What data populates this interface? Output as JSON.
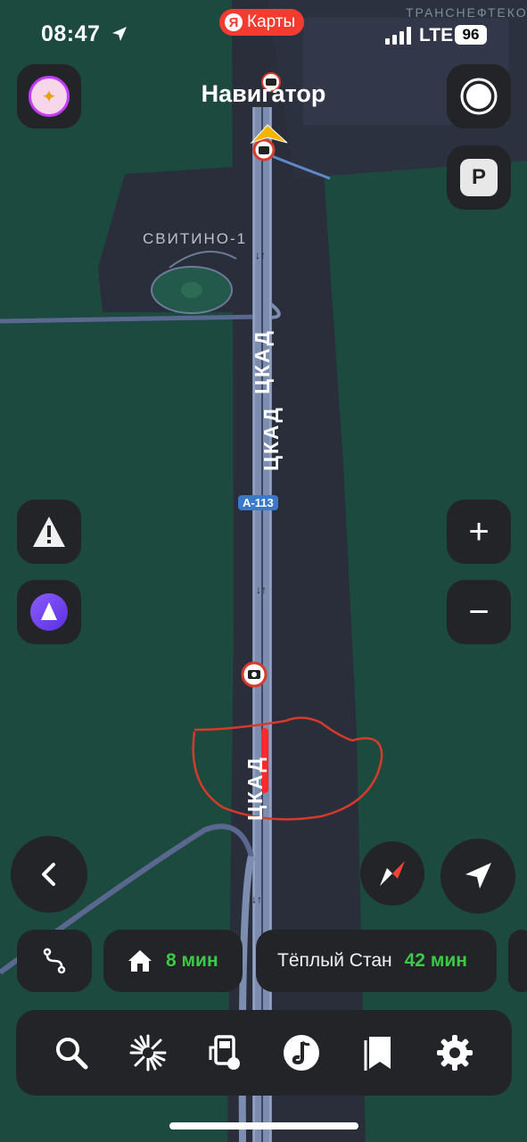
{
  "status": {
    "time": "08:47",
    "network": "LTE",
    "battery": "96",
    "app_pill": "Карты",
    "app_pill_logo": "Я"
  },
  "map": {
    "top_corner_label": "ТРАНСНЕФТЕКОМП",
    "place_label": "СВИТИНО-1",
    "road_label_1": "ЦКАД",
    "road_label_2": "ЦКАД",
    "road_label_3": "ЦКАД",
    "route_shield": "А-113",
    "colors": {
      "land": "#1c4a3e",
      "urban": "#2a2e3b",
      "road": "#7d8db0",
      "annotation": "#d53a2b",
      "accent_green": "#3cc948",
      "marker_yellow": "#f5b400"
    }
  },
  "header": {
    "title": "Навигатор"
  },
  "chips": [
    {
      "icon": "route-icon"
    },
    {
      "icon": "home-icon",
      "eta": "8 мин"
    },
    {
      "label": "Тёплый Стан",
      "eta": "42 мин"
    }
  ],
  "icons": {
    "left_top": "sparkle-avatar-icon",
    "right_top": "speed-dial-icon",
    "parking": "P",
    "warning": "!",
    "alice": "alice-icon",
    "zoom_in": "+",
    "zoom_out": "−",
    "back": "chevron-left-icon",
    "compass": "compass-icon",
    "locate": "navigation-arrow-icon"
  },
  "bottom_bar": [
    {
      "name": "search-icon"
    },
    {
      "name": "explore-icon"
    },
    {
      "name": "fuel-icon"
    },
    {
      "name": "music-icon"
    },
    {
      "name": "bookmarks-icon"
    },
    {
      "name": "settings-icon"
    }
  ]
}
